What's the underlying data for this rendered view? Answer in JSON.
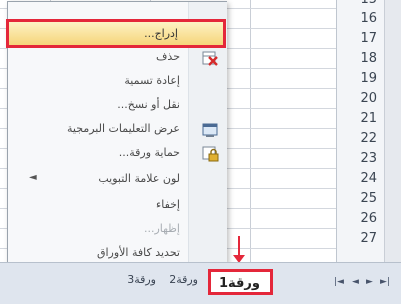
{
  "row_numbers": [
    "15",
    "16",
    "17",
    "18",
    "19",
    "20",
    "21",
    "22",
    "23",
    "24",
    "25",
    "26",
    "27"
  ],
  "context_menu": {
    "items": [
      {
        "label": "إدراج...",
        "icon": "",
        "highlighted": true
      },
      {
        "label": "حذف",
        "icon": "delete-sheet-icon"
      },
      {
        "label": "إعادة تسمية",
        "icon": ""
      },
      {
        "label": "نقل أو نسخ...",
        "icon": ""
      },
      {
        "label": "عرض التعليمات البرمجية",
        "icon": "view-code-icon"
      },
      {
        "label": "حماية ورقة...",
        "icon": "protect-sheet-icon"
      },
      {
        "label": "لون علامة التبويب",
        "icon": "",
        "submenu": true
      },
      {
        "label": "إخفاء",
        "icon": ""
      },
      {
        "label": "إظهار...",
        "icon": "",
        "disabled": true
      },
      {
        "label": "تحديد كافة الأوراق",
        "icon": ""
      }
    ]
  },
  "sheet_tabs": {
    "active_label": "ورقة1",
    "other_labels": [
      "ورقة2",
      "ورقة3"
    ]
  },
  "accent_color": "#e4273a"
}
